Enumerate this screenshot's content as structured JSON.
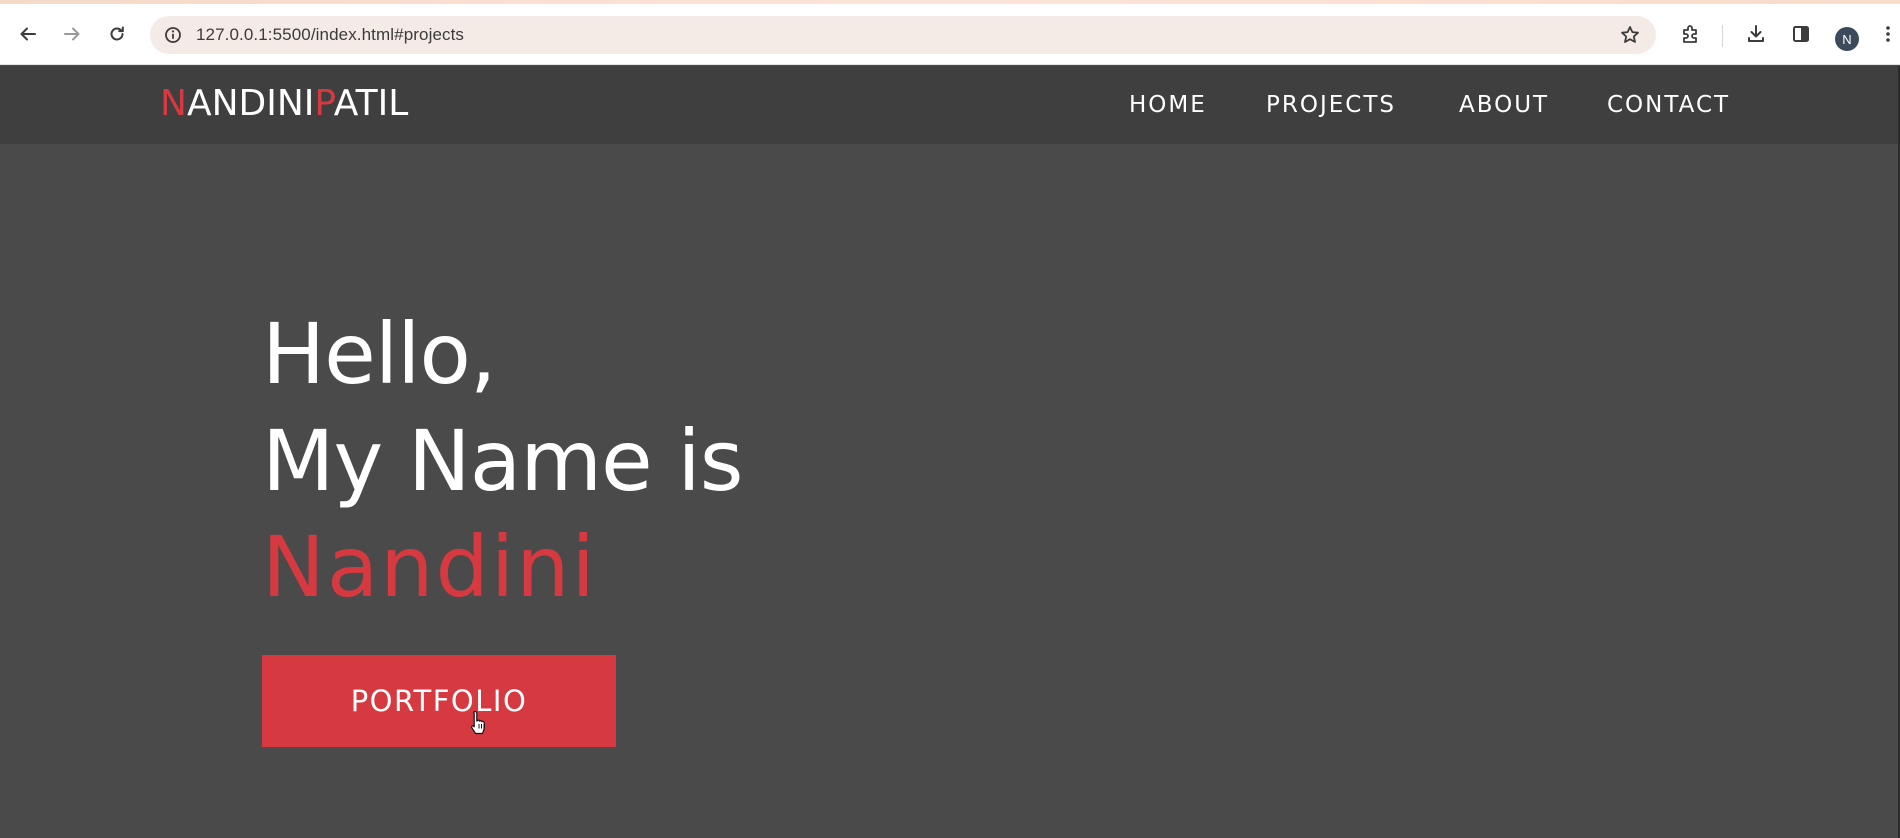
{
  "browser": {
    "url": "127.0.0.1:5500/index.html#projects",
    "profile_initial": "N",
    "icons": [
      "back-icon",
      "forward-icon",
      "reload-icon",
      "site-info-icon",
      "bookmark-star-icon",
      "extensions-icon",
      "downloads-icon",
      "side-panel-icon",
      "profile-avatar",
      "kebab-menu-icon"
    ]
  },
  "site": {
    "logo": {
      "first_initial": "N",
      "first_rest": "ANDINI",
      "last_initial": "P",
      "last_rest": "ATIL"
    },
    "nav": {
      "home": "HOME",
      "projects": "PROJECTS",
      "about": "ABOUT",
      "contact": "CONTACT"
    }
  },
  "hero": {
    "line1": "Hello,",
    "line2": "My Name is",
    "name": "Nandini",
    "button_label": "PORTFOLIO"
  },
  "colors": {
    "accent": "#d63a40",
    "header_bg": "#3f3f3f",
    "hero_bg": "#4a4a4a",
    "text": "#ffffff"
  }
}
